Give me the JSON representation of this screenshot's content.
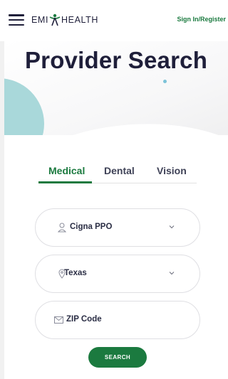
{
  "header": {
    "logo_left": "EMI",
    "logo_right": "HEALTH",
    "signin_label": "Sign In/Register"
  },
  "hero": {
    "title": "Provider Search"
  },
  "tabs": [
    {
      "label": "Medical",
      "active": true
    },
    {
      "label": "Dental",
      "active": false
    },
    {
      "label": "Vision",
      "active": false
    }
  ],
  "form": {
    "plan": {
      "value": "Cigna PPO",
      "icon": "user-icon"
    },
    "state": {
      "value": "Texas",
      "icon": "location-pin-icon"
    },
    "zip": {
      "placeholder": "ZIP Code",
      "icon": "envelope-icon"
    },
    "search_label": "SEARCH"
  },
  "colors": {
    "brand_green": "#1b7a3f",
    "navy": "#1f1f3a",
    "teal": "#a9d8da"
  }
}
